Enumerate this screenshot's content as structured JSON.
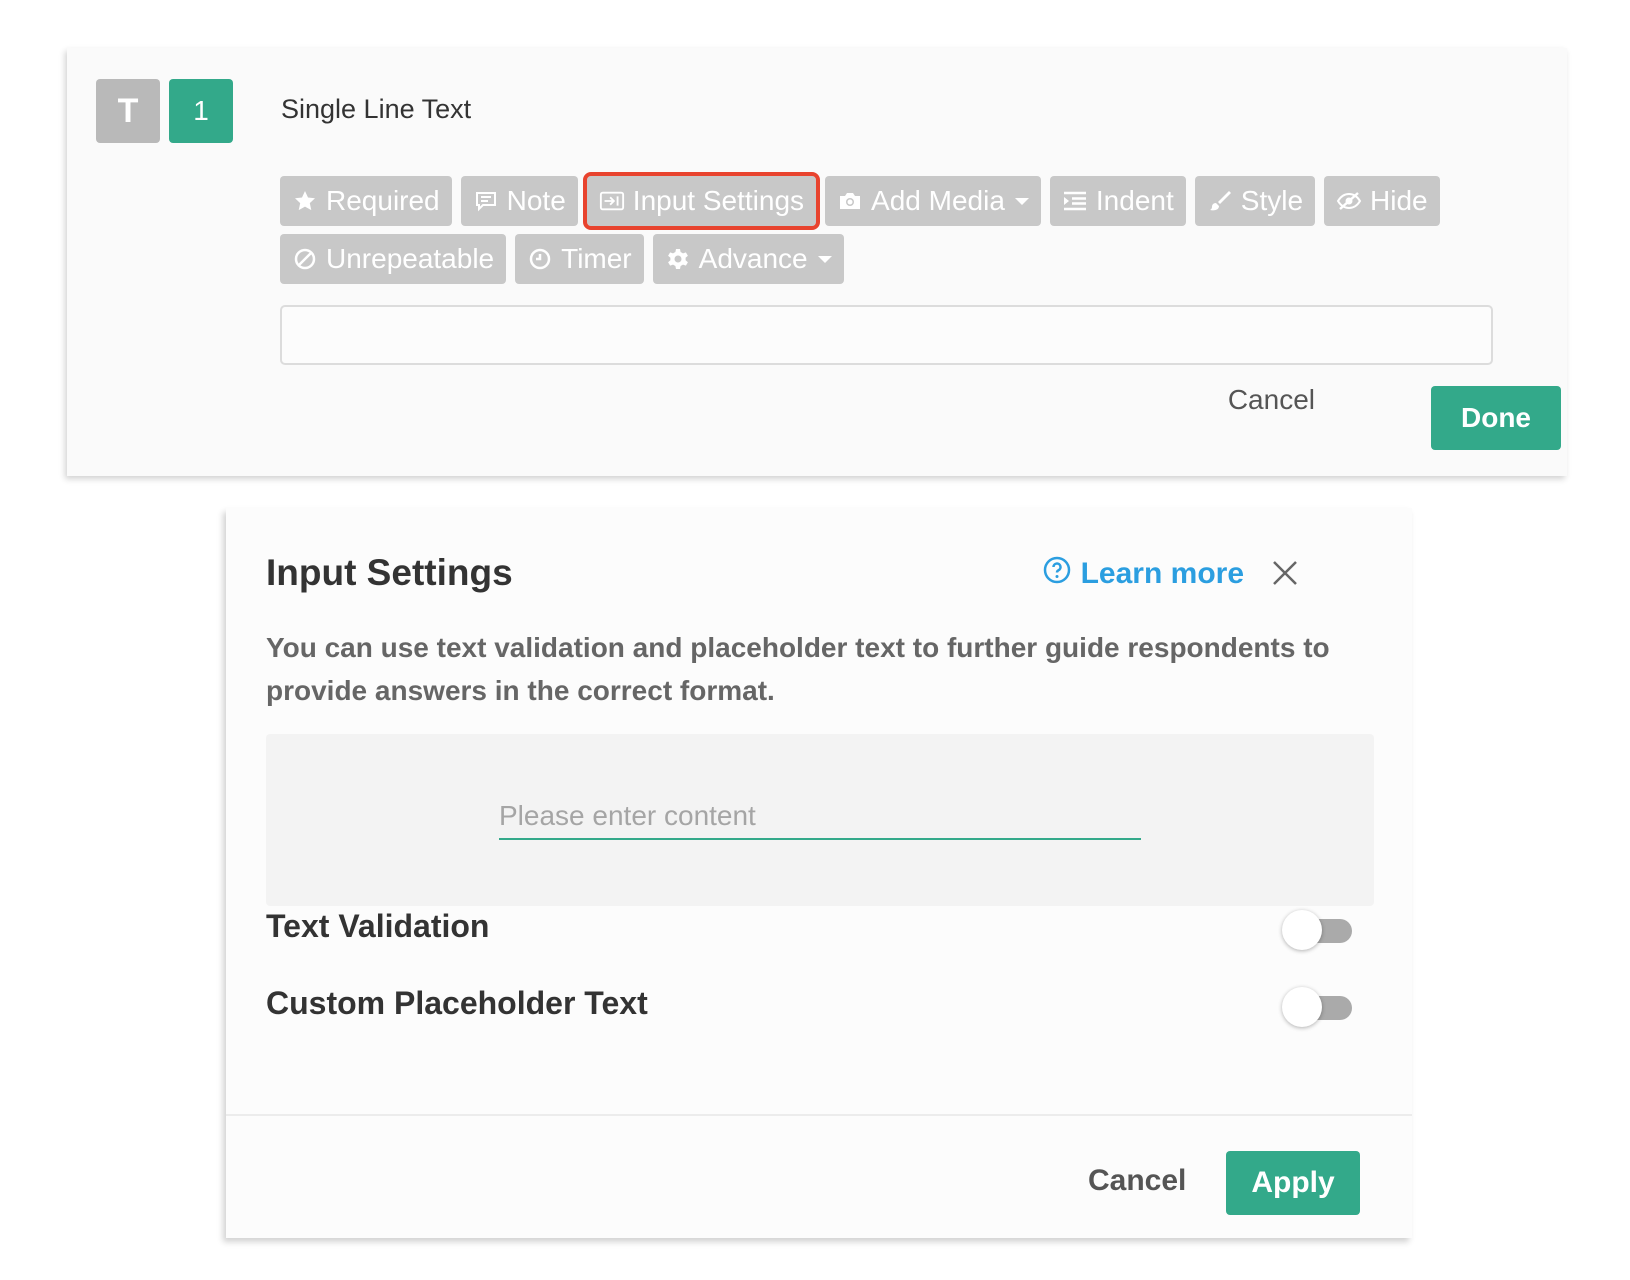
{
  "question": {
    "type_icon": "T",
    "number": "1",
    "title": "Single Line Text"
  },
  "toolbar": {
    "row1": [
      {
        "label": "Required",
        "icon": "star-icon"
      },
      {
        "label": "Note",
        "icon": "note-icon"
      },
      {
        "label": "Input Settings",
        "icon": "input-settings-icon",
        "highlighted": true
      },
      {
        "label": "Add Media",
        "icon": "camera-icon",
        "dropdown": true
      },
      {
        "label": "Indent",
        "icon": "indent-icon"
      },
      {
        "label": "Style",
        "icon": "brush-icon"
      },
      {
        "label": "Hide",
        "icon": "eye-slash-icon"
      }
    ],
    "row2": [
      {
        "label": "Unrepeatable",
        "icon": "ban-icon"
      },
      {
        "label": "Timer",
        "icon": "clock-icon"
      },
      {
        "label": "Advance",
        "icon": "gear-icon",
        "dropdown": true
      }
    ]
  },
  "editor_actions": {
    "cancel": "Cancel",
    "done": "Done"
  },
  "dialog": {
    "title": "Input Settings",
    "learn_more": "Learn more",
    "description": "You can use text validation and placeholder text to further guide respondents to provide answers in the correct format.",
    "preview_placeholder": "Please enter content",
    "settings": [
      {
        "label": "Text Validation",
        "enabled": false
      },
      {
        "label": "Custom Placeholder Text",
        "enabled": false
      }
    ],
    "cancel": "Cancel",
    "apply": "Apply"
  },
  "colors": {
    "accent": "#33a98a",
    "toolbar_button": "#c8c8c8",
    "highlight_outline": "#e8432e",
    "link": "#2b9ee0"
  }
}
